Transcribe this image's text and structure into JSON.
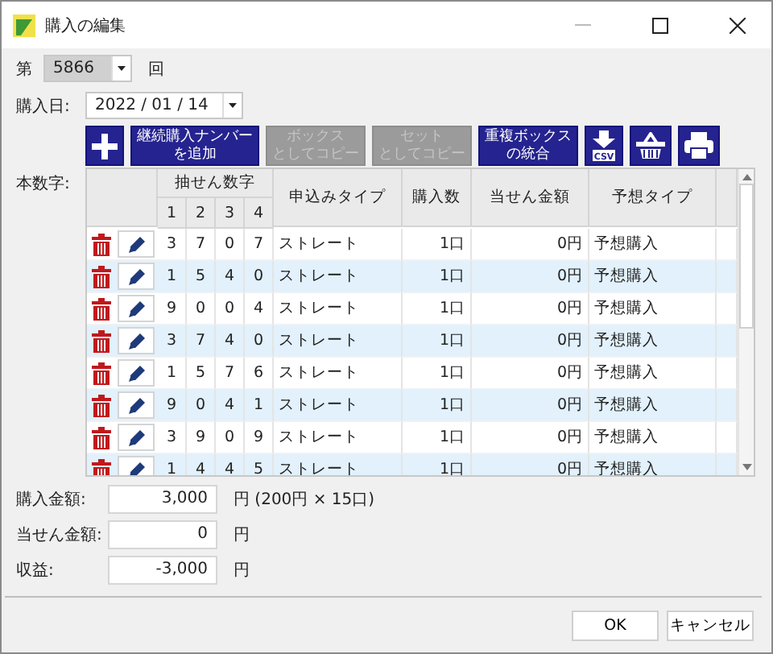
{
  "window": {
    "title": "購入の編集"
  },
  "draw": {
    "label": "第",
    "value": "5866",
    "suffix": "回"
  },
  "purchase_date": {
    "label": "購入日:",
    "value": "2022 / 01 / 14"
  },
  "toolbar": [
    {
      "kind": "add",
      "disabled": false
    },
    {
      "kind": "text",
      "lines": [
        "継続購入ナンバー",
        "を追加"
      ],
      "disabled": false
    },
    {
      "kind": "text",
      "lines": [
        "ボックス",
        "としてコピー"
      ],
      "disabled": true
    },
    {
      "kind": "text",
      "lines": [
        "セット",
        "としてコピー"
      ],
      "disabled": true
    },
    {
      "kind": "text",
      "lines": [
        "重複ボックス",
        "の統合"
      ],
      "disabled": false
    },
    {
      "kind": "csv",
      "label": "CSV",
      "disabled": false
    },
    {
      "kind": "basket",
      "disabled": false
    },
    {
      "kind": "print",
      "disabled": false
    }
  ],
  "numbers_label": "本数字:",
  "table": {
    "digit_group": "抽せん数字",
    "digit_columns": [
      "1",
      "2",
      "3",
      "4"
    ],
    "columns": [
      "申込みタイプ",
      "購入数",
      "当せん金額",
      "予想タイプ"
    ],
    "rows": [
      {
        "digits": [
          "3",
          "7",
          "0",
          "7"
        ],
        "type": "ストレート",
        "count": "1口",
        "amount": "0円",
        "forecast": "予想購入"
      },
      {
        "digits": [
          "1",
          "5",
          "4",
          "0"
        ],
        "type": "ストレート",
        "count": "1口",
        "amount": "0円",
        "forecast": "予想購入"
      },
      {
        "digits": [
          "9",
          "0",
          "0",
          "4"
        ],
        "type": "ストレート",
        "count": "1口",
        "amount": "0円",
        "forecast": "予想購入"
      },
      {
        "digits": [
          "3",
          "7",
          "4",
          "0"
        ],
        "type": "ストレート",
        "count": "1口",
        "amount": "0円",
        "forecast": "予想購入"
      },
      {
        "digits": [
          "1",
          "5",
          "7",
          "6"
        ],
        "type": "ストレート",
        "count": "1口",
        "amount": "0円",
        "forecast": "予想購入"
      },
      {
        "digits": [
          "9",
          "0",
          "4",
          "1"
        ],
        "type": "ストレート",
        "count": "1口",
        "amount": "0円",
        "forecast": "予想購入"
      },
      {
        "digits": [
          "3",
          "9",
          "0",
          "9"
        ],
        "type": "ストレート",
        "count": "1口",
        "amount": "0円",
        "forecast": "予想購入"
      },
      {
        "digits": [
          "1",
          "4",
          "4",
          "5"
        ],
        "type": "ストレート",
        "count": "1口",
        "amount": "0円",
        "forecast": "予想購入"
      }
    ]
  },
  "totals": [
    {
      "label": "購入金額:",
      "value": "3,000",
      "unit": "円 (200円 × 15口)"
    },
    {
      "label": "当せん金額:",
      "value": "0",
      "unit": "円"
    },
    {
      "label": "収益:",
      "value": "-3,000",
      "unit": "円"
    }
  ],
  "buttons": [
    "OK",
    "キャンセル"
  ]
}
